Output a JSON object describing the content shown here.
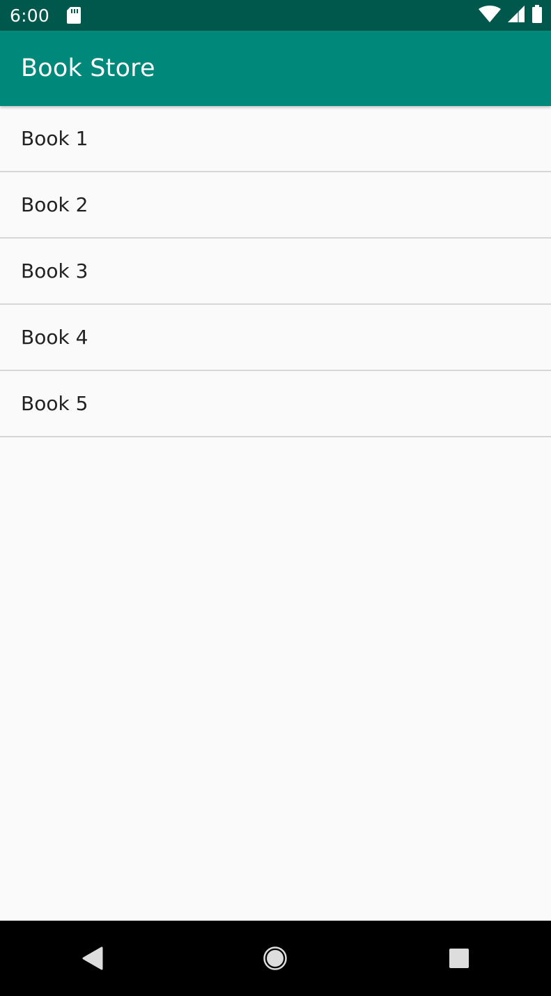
{
  "status_bar": {
    "time": "6:00",
    "icons": [
      "sd-card-icon",
      "wifi-icon",
      "signal-icon",
      "battery-icon"
    ]
  },
  "app_bar": {
    "title": "Book Store"
  },
  "books": [
    {
      "label": "Book 1"
    },
    {
      "label": "Book 2"
    },
    {
      "label": "Book 3"
    },
    {
      "label": "Book 4"
    },
    {
      "label": "Book 5"
    }
  ],
  "navigation": {
    "icons": [
      "back-icon",
      "home-icon",
      "recents-icon"
    ]
  },
  "colors": {
    "status_bar": "#00574b",
    "app_bar": "#00897b",
    "background": "#fafafa",
    "divider": "#d7d7d7",
    "nav_bar": "#000000"
  }
}
